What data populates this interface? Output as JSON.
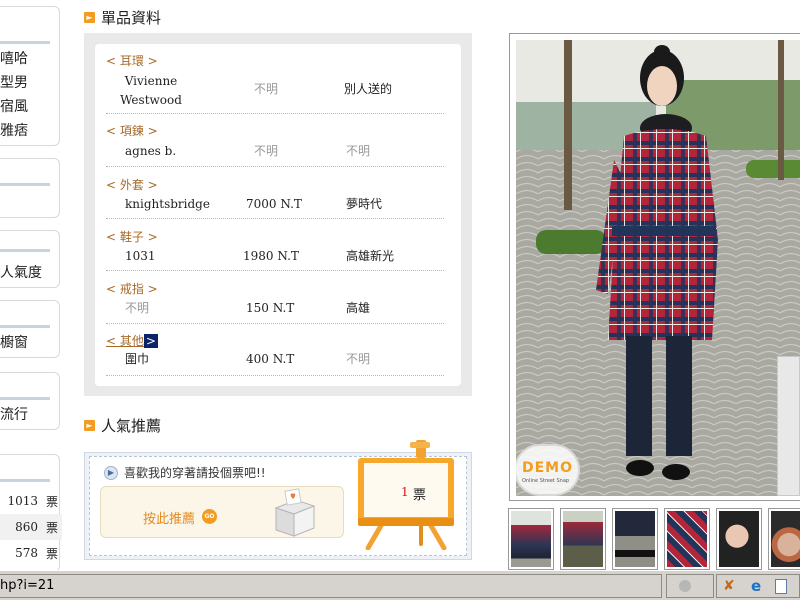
{
  "sidebar": {
    "box1_items": [
      "嘻哈",
      "型男",
      "宿風",
      "雅痞"
    ],
    "box3_label": "人氣度",
    "box4_label": "櫥窗",
    "box5_label": "流行",
    "rank_rows": [
      {
        "count": "1013",
        "unit": "票"
      },
      {
        "count": "860",
        "unit": "票"
      },
      {
        "count": "578",
        "unit": "票"
      }
    ]
  },
  "items_section": {
    "title": "單品資料",
    "items": [
      {
        "category": "< 耳環 >",
        "brand": "Vivienne Westwood",
        "price": "不明",
        "source": "別人送的"
      },
      {
        "category": "< 項鍊 >",
        "brand": "agnes b.",
        "price": "不明",
        "source": "不明"
      },
      {
        "category": "< 外套 >",
        "brand": "knightsbridge",
        "price": "7000 N.T",
        "source": "夢時代"
      },
      {
        "category": "< 鞋子 >",
        "brand": "1031",
        "price": "1980 N.T",
        "source": "高雄新光"
      },
      {
        "category": "< 戒指 >",
        "brand": "不明",
        "price": "150 N.T",
        "source": "高雄"
      },
      {
        "category_left": "< 其他",
        "category_right": ">",
        "brand": "圍巾",
        "price": "400 N.T",
        "source": "不明"
      }
    ]
  },
  "vote_section": {
    "title": "人氣推薦",
    "prompt": "喜歡我的穿著請投個票吧!!",
    "button_label": "按此推薦",
    "go_label": "GO",
    "count": "1",
    "unit": "票"
  },
  "photo": {
    "watermark_main": "DEMO",
    "watermark_sub": "Online Street Snap"
  },
  "statusbar": {
    "url": "hp?i=21"
  },
  "colors": {
    "accent_orange": "#f39c1f",
    "category_brown": "#a86a2a",
    "muted_gray": "#999999"
  }
}
